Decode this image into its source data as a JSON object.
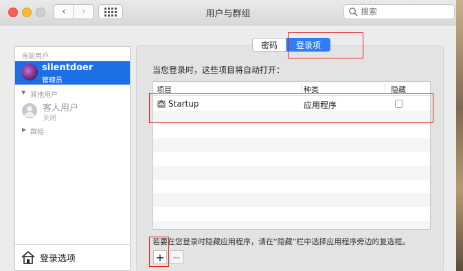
{
  "window": {
    "title": "用户与群组"
  },
  "search": {
    "placeholder": "搜索"
  },
  "sidebar": {
    "current_users_header": "当前用户",
    "current_user": {
      "name": "silentdoer",
      "role": "管理员"
    },
    "other_users_header": "其他用户",
    "guest": {
      "name": "客人用户",
      "status": "关闭"
    },
    "groups_header": "群组",
    "login_options_label": "登录选项"
  },
  "tabs": [
    {
      "label": "密码",
      "selected": false
    },
    {
      "label": "登录项",
      "selected": true
    }
  ],
  "main": {
    "description": "当您登录时，这些项目将自动打开：",
    "columns": [
      "项目",
      "种类",
      "隐藏"
    ],
    "items": [
      {
        "name": "Startup",
        "kind": "应用程序",
        "hidden": false
      }
    ],
    "hint": "若要在您登录时隐藏应用程序，请在“隐藏”栏中选择应用程序旁边的复选框。",
    "add_label": "+",
    "remove_label": "−"
  },
  "colors": {
    "accent": "#2f7cf6",
    "selection": "#1e6ee6",
    "annotation": "#e02020"
  }
}
